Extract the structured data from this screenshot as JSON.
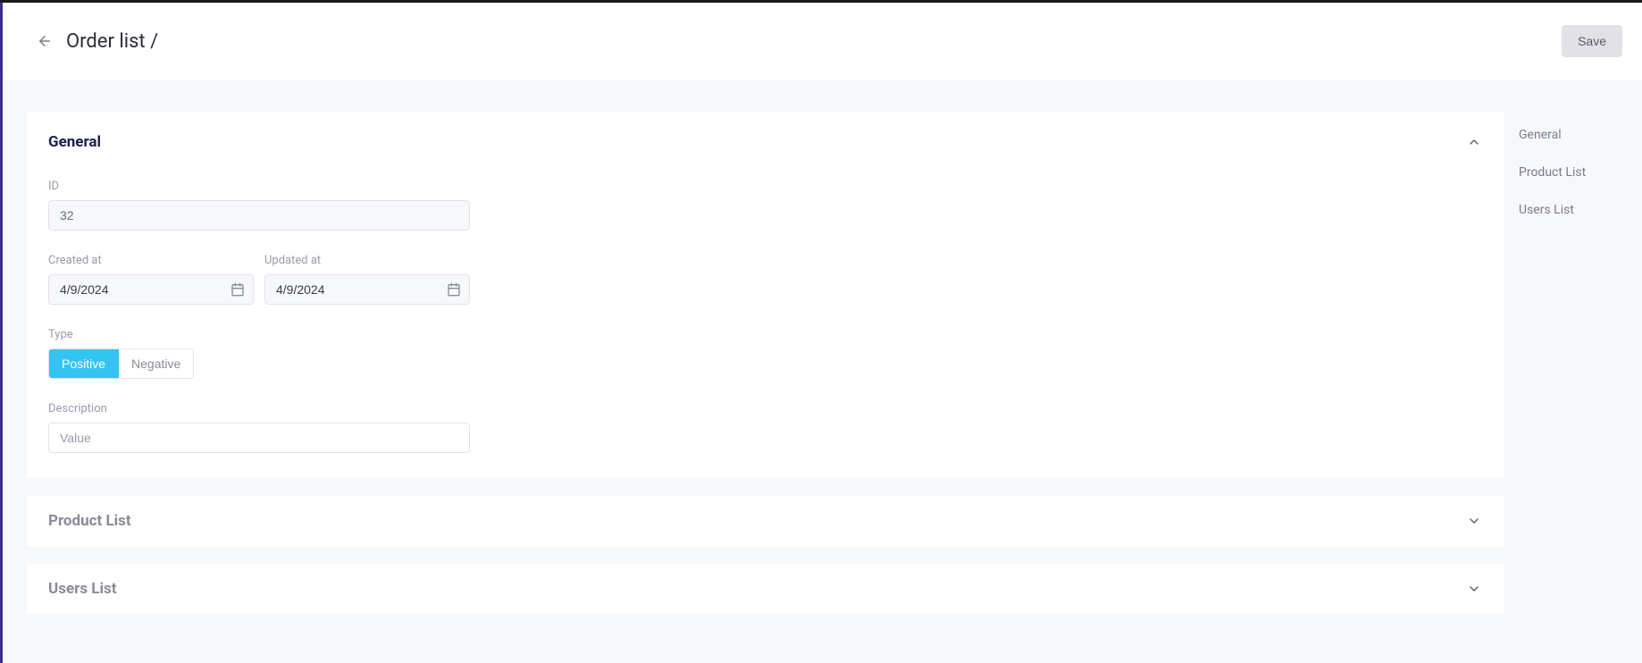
{
  "header": {
    "title": "Order list /",
    "save_label": "Save"
  },
  "nav": {
    "items": [
      "General",
      "Product List",
      "Users List"
    ]
  },
  "sections": {
    "general": {
      "title": "General",
      "fields": {
        "id": {
          "label": "ID",
          "value": "32"
        },
        "created_at": {
          "label": "Created at",
          "value": "4/9/2024"
        },
        "updated_at": {
          "label": "Updated at",
          "value": "4/9/2024"
        },
        "type": {
          "label": "Type",
          "options": {
            "positive": "Positive",
            "negative": "Negative"
          },
          "selected": "positive"
        },
        "description": {
          "label": "Description",
          "value": "",
          "placeholder": "Value"
        }
      }
    },
    "product_list": {
      "title": "Product List"
    },
    "users_list": {
      "title": "Users List"
    }
  }
}
